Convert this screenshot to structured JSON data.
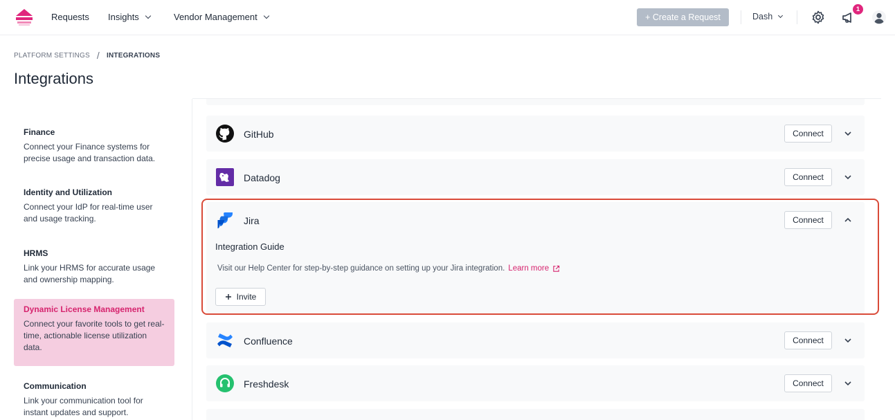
{
  "topnav": {
    "items": [
      {
        "label": "Requests"
      },
      {
        "label": "Insights"
      },
      {
        "label": "Vendor Management"
      }
    ],
    "create_label": "+ Create a Request",
    "workspace": "Dash",
    "notif_count": "1"
  },
  "breadcrumb": {
    "parent": "PLATFORM SETTINGS",
    "separator": "/",
    "current": "INTEGRATIONS"
  },
  "page_title": "Integrations",
  "sidebar": {
    "items": [
      {
        "title": "Finance",
        "desc": "Connect your Finance systems for precise usage and transaction data."
      },
      {
        "title": "Identity and Utilization",
        "desc": "Connect your IdP for real-time user and usage tracking."
      },
      {
        "title": "HRMS",
        "desc": "Link your HRMS for accurate usage and ownership mapping."
      },
      {
        "title": "Dynamic License Management",
        "desc": "Connect your favorite tools to get real-time, actionable license utilization data."
      },
      {
        "title": "Communication",
        "desc": "Link your communication tool for instant updates and support."
      }
    ]
  },
  "integrations": [
    {
      "name": "GitHub",
      "connect": "Connect"
    },
    {
      "name": "Datadog",
      "connect": "Connect"
    },
    {
      "name": "Jira",
      "connect": "Connect",
      "expanded": true,
      "guide_title": "Integration Guide",
      "guide_text": "Visit our Help Center for step-by-step guidance on setting up your Jira integration.",
      "learn_more": "Learn more",
      "invite": "Invite"
    },
    {
      "name": "Confluence",
      "connect": "Connect"
    },
    {
      "name": "Freshdesk",
      "connect": "Connect"
    }
  ],
  "colors": {
    "accent": "#d6246e",
    "highlight": "#d94a38",
    "active_bg": "#f5cde0"
  }
}
